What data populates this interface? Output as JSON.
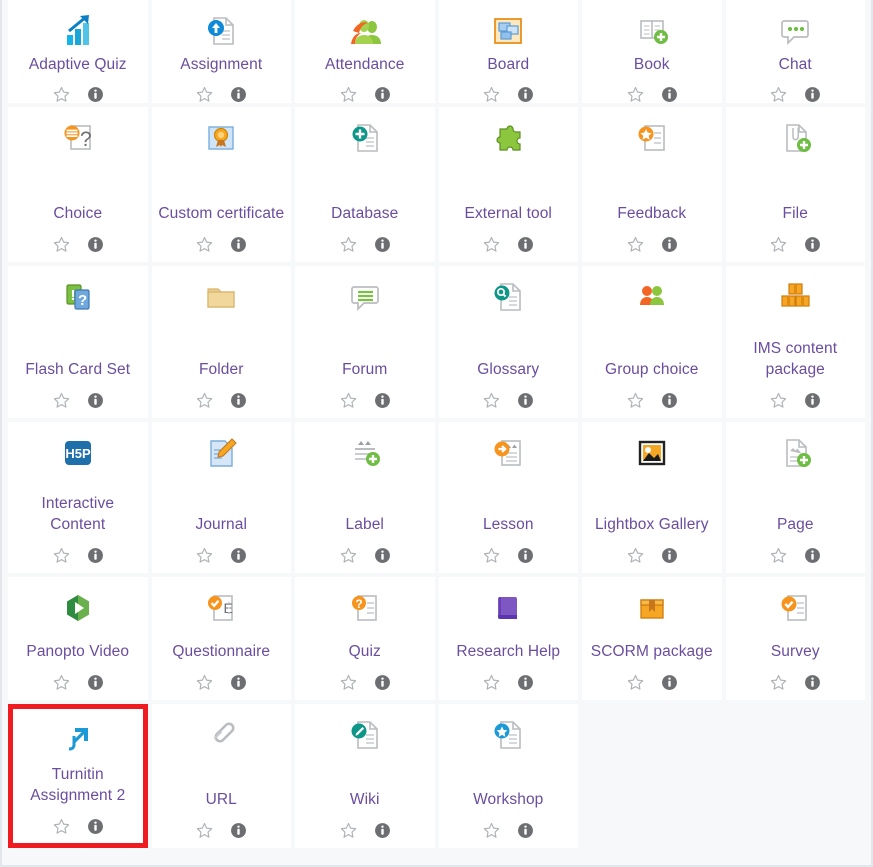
{
  "chooser": {
    "name": "activity-chooser-grid",
    "columns": 6,
    "accent_purple": "#6a4d9e",
    "background": "#f6f8fa",
    "tile_background": "#ffffff",
    "highlight_color": "#ee1b20",
    "star_icon_name": "star-outline-icon",
    "info_icon_name": "info-circle-icon",
    "star_label": "Add to favourites",
    "info_label": "Help with this activity"
  },
  "rows": [
    {
      "id": "row-1",
      "items": [
        {
          "label": "Adaptive Quiz",
          "icon": "adaptive-quiz-icon",
          "highlighted": false
        },
        {
          "label": "Assignment",
          "icon": "assignment-icon",
          "highlighted": false
        },
        {
          "label": "Attendance",
          "icon": "attendance-icon",
          "highlighted": false
        },
        {
          "label": "Board",
          "icon": "board-icon",
          "highlighted": false
        },
        {
          "label": "Book",
          "icon": "book-icon",
          "highlighted": false
        },
        {
          "label": "Chat",
          "icon": "chat-icon",
          "highlighted": false
        }
      ]
    },
    {
      "id": "row-2",
      "items": [
        {
          "label": "Choice",
          "icon": "choice-icon",
          "highlighted": false
        },
        {
          "label": "Custom certificate",
          "icon": "custom-certificate-icon",
          "highlighted": false
        },
        {
          "label": "Database",
          "icon": "database-icon",
          "highlighted": false
        },
        {
          "label": "External tool",
          "icon": "external-tool-icon",
          "highlighted": false
        },
        {
          "label": "Feedback",
          "icon": "feedback-icon",
          "highlighted": false
        },
        {
          "label": "File",
          "icon": "file-icon",
          "highlighted": false
        }
      ]
    },
    {
      "id": "row-3",
      "items": [
        {
          "label": "Flash Card Set",
          "icon": "flash-card-set-icon",
          "highlighted": false
        },
        {
          "label": "Folder",
          "icon": "folder-icon",
          "highlighted": false
        },
        {
          "label": "Forum",
          "icon": "forum-icon",
          "highlighted": false
        },
        {
          "label": "Glossary",
          "icon": "glossary-icon",
          "highlighted": false
        },
        {
          "label": "Group choice",
          "icon": "group-choice-icon",
          "highlighted": false
        },
        {
          "label": "IMS content package",
          "icon": "ims-content-package-icon",
          "highlighted": false
        }
      ]
    },
    {
      "id": "row-4",
      "items": [
        {
          "label": "Interactive Content",
          "icon": "h5p-interactive-content-icon",
          "highlighted": false
        },
        {
          "label": "Journal",
          "icon": "journal-icon",
          "highlighted": false
        },
        {
          "label": "Label",
          "icon": "label-icon",
          "highlighted": false
        },
        {
          "label": "Lesson",
          "icon": "lesson-icon",
          "highlighted": false
        },
        {
          "label": "Lightbox Gallery",
          "icon": "lightbox-gallery-icon",
          "highlighted": false
        },
        {
          "label": "Page",
          "icon": "page-icon",
          "highlighted": false
        }
      ]
    },
    {
      "id": "row-5",
      "items": [
        {
          "label": "Panopto Video",
          "icon": "panopto-video-icon",
          "highlighted": false
        },
        {
          "label": "Questionnaire",
          "icon": "questionnaire-icon",
          "highlighted": false
        },
        {
          "label": "Quiz",
          "icon": "quiz-icon",
          "highlighted": false
        },
        {
          "label": "Research Help",
          "icon": "research-help-icon",
          "highlighted": false
        },
        {
          "label": "SCORM package",
          "icon": "scorm-package-icon",
          "highlighted": false
        },
        {
          "label": "Survey",
          "icon": "survey-icon",
          "highlighted": false
        }
      ]
    },
    {
      "id": "row-6",
      "items": [
        {
          "label": "Turnitin Assignment 2",
          "icon": "turnitin-assignment-2-icon",
          "highlighted": true
        },
        {
          "label": "URL",
          "icon": "url-link-icon",
          "highlighted": false
        },
        {
          "label": "Wiki",
          "icon": "wiki-icon",
          "highlighted": false
        },
        {
          "label": "Workshop",
          "icon": "workshop-icon",
          "highlighted": false
        },
        {
          "label": "",
          "icon": "",
          "highlighted": false
        },
        {
          "label": "",
          "icon": "",
          "highlighted": false
        }
      ]
    }
  ]
}
